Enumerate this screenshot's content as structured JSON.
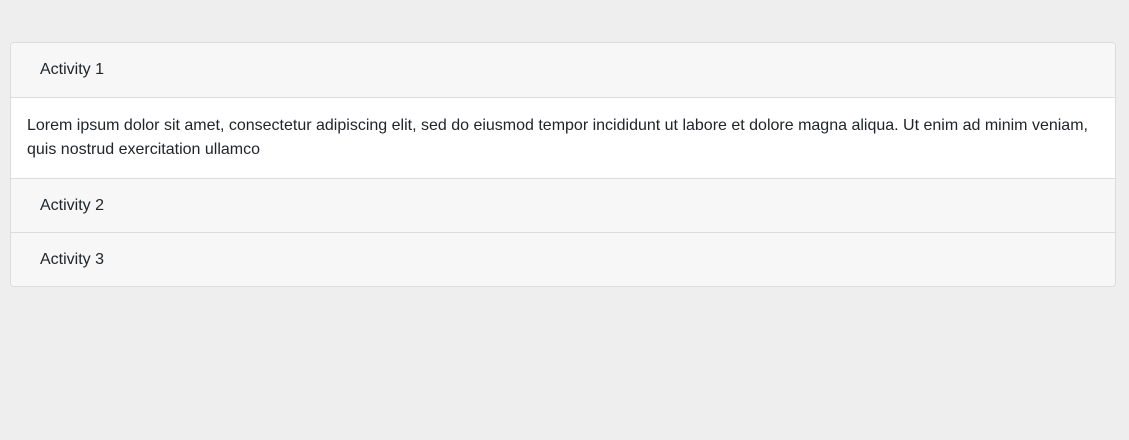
{
  "accordion": {
    "items": [
      {
        "title": "Activity 1",
        "expanded": true,
        "body": "Lorem ipsum dolor sit amet, consectetur adipiscing elit, sed do eiusmod tempor incididunt ut labore et dolore magna aliqua. Ut enim ad minim veniam, quis nostrud exercitation ullamco"
      },
      {
        "title": "Activity 2",
        "expanded": false
      },
      {
        "title": "Activity 3",
        "expanded": false
      }
    ]
  }
}
